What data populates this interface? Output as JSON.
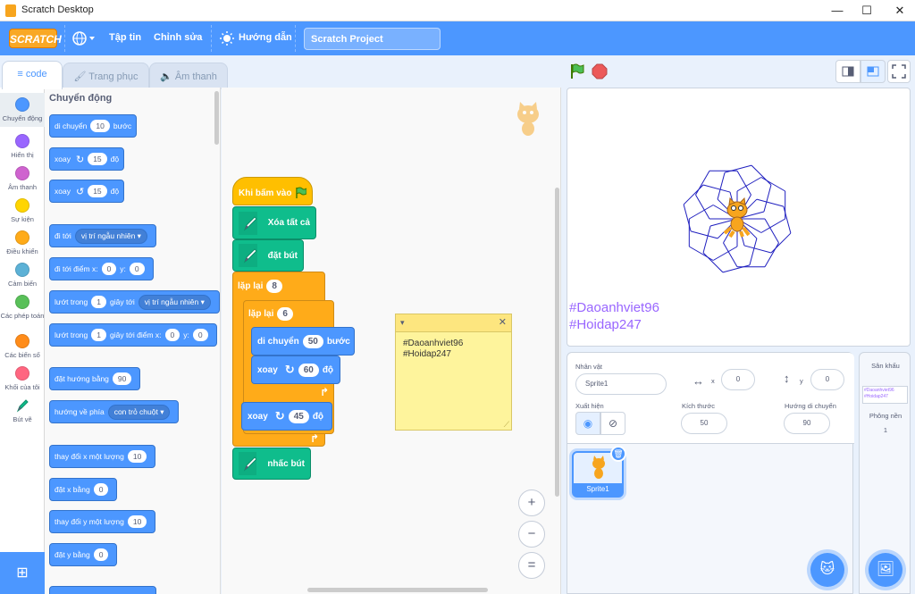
{
  "window": {
    "title": "Scratch Desktop",
    "minimize": "—",
    "maximize": "☐",
    "close": "✕"
  },
  "menu": {
    "logo": "SCRATCH",
    "file": "Tập tin",
    "edit": "Chỉnh sửa",
    "tutorials": "Hướng dẫn",
    "project_title": "Scratch Project"
  },
  "tabs": {
    "code": "code",
    "costumes": "Trang phục",
    "sounds": "Âm thanh"
  },
  "categories": [
    {
      "label": "Chuyển động",
      "color": "#4c97ff"
    },
    {
      "label": "Hiển thị",
      "color": "#9966ff"
    },
    {
      "label": "Âm thanh",
      "color": "#cf63cf"
    },
    {
      "label": "Sự kiện",
      "color": "#ffd500"
    },
    {
      "label": "Điều khiển",
      "color": "#ffab19"
    },
    {
      "label": "Cảm biến",
      "color": "#5cb1d6"
    },
    {
      "label": "Các phép toán",
      "color": "#59c059"
    },
    {
      "label": "Các biến số",
      "color": "#ff8c1a"
    },
    {
      "label": "Khối của tôi",
      "color": "#ff6680"
    },
    {
      "label": "Bút vẽ",
      "color": "#0fbd8c"
    }
  ],
  "palette": {
    "heading": "Chuyển động",
    "move": {
      "label": "di chuyển",
      "value": "10",
      "unit": "bước"
    },
    "turn_right": {
      "label": "xoay",
      "value": "15",
      "unit": "độ"
    },
    "turn_left": {
      "label": "xoay",
      "value": "15",
      "unit": "độ"
    },
    "goto": {
      "label": "đi tới",
      "option": "vị trí ngẫu nhiên"
    },
    "goto_xy": {
      "label": "đi tới điểm x:",
      "x": "0",
      "ylabel": "y:",
      "y": "0"
    },
    "glide": {
      "label": "lướt trong",
      "value": "1",
      "mid": "giây tới",
      "option": "vị trí ngẫu nhiên"
    },
    "glide_xy": {
      "label": "lướt trong",
      "value": "1",
      "mid": "giây tới điểm x:",
      "x": "0",
      "ylabel": "y:",
      "y": "0"
    },
    "point_dir": {
      "label": "đặt hướng bằng",
      "value": "90"
    },
    "point_towards": {
      "label": "hướng về phía",
      "option": "con trỏ chuột"
    },
    "change_x": {
      "label": "thay đổi x một lượng",
      "value": "10"
    },
    "set_x": {
      "label": "đặt x bằng",
      "value": "0"
    },
    "change_y": {
      "label": "thay đổi y một lượng",
      "value": "10"
    },
    "set_y": {
      "label": "đặt y bằng",
      "value": "0"
    }
  },
  "script": {
    "hat": "Khi bấm vào",
    "clear": "Xóa tất cả",
    "pen_down": "đặt bút",
    "repeat_outer": {
      "label": "lặp lại",
      "value": "8"
    },
    "repeat_inner": {
      "label": "lặp lại",
      "value": "6"
    },
    "move": {
      "label": "di chuyển",
      "value": "50",
      "unit": "bước"
    },
    "turn_inner": {
      "label": "xoay",
      "value": "60",
      "unit": "độ"
    },
    "turn_outer": {
      "label": "xoay",
      "value": "45",
      "unit": "độ"
    },
    "pen_up": "nhấc bút"
  },
  "note": {
    "line1": "#Daoanhviet96",
    "line2": "#Hoidap247"
  },
  "zoom": {
    "in": "+",
    "out": "−",
    "reset": "="
  },
  "stage": {
    "text1": "#Daoanhviet96",
    "text2": "#Hoidap247"
  },
  "sprite_info": {
    "sprite_label": "Nhân vật",
    "sprite_name": "Sprite1",
    "x_label": "x",
    "x": "0",
    "y_label": "y",
    "y": "0",
    "show_label": "Xuất hiện",
    "size_label": "Kích thước",
    "size": "50",
    "direction_label": "Hướng di chuyển",
    "direction": "90"
  },
  "sprites": [
    {
      "name": "Sprite1"
    }
  ],
  "stage_pane": {
    "title": "Sân khấu",
    "backdrops_label": "Phông nền",
    "backdrops_count": "1",
    "thumb_text1": "#Daoanhviet96",
    "thumb_text2": "#Hoidap247"
  }
}
